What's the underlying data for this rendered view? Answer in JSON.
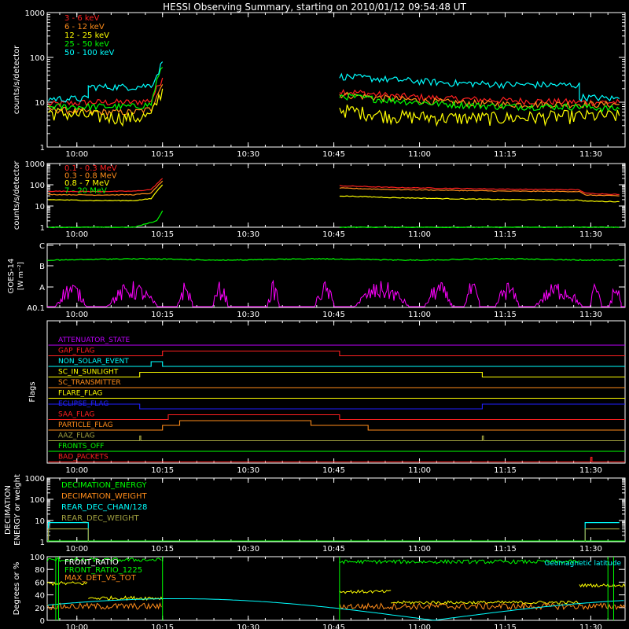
{
  "title": "HESSI Observing Summary, starting on 2010/01/12 09:54:48 UT",
  "time_axis": {
    "labels": [
      "10:00",
      "10:15",
      "10:30",
      "10:45",
      "11:00",
      "11:15",
      "11:30"
    ],
    "minor_ticks_per_label": 5
  },
  "colors": {
    "red": "#ff2020",
    "orange": "#ff8c1a",
    "yellow": "#ffff00",
    "green": "#00ff00",
    "cyan": "#00ffff",
    "magenta": "#ff00ff",
    "blue": "#2020ff",
    "purple": "#c000ff",
    "olive": "#a0a040",
    "white": "#ffffff"
  },
  "chart_data": [
    {
      "type": "line",
      "panel": "low-energy",
      "ylabel": "counts/s/detector",
      "yscale": "log",
      "ylim": [
        1,
        1000
      ],
      "ytick_labels": [
        "1",
        "10",
        "100",
        "1000"
      ],
      "legend": "top-left",
      "series": [
        {
          "name": "3 - 6 keV",
          "color": "red",
          "segments": [
            {
              "x": [
                "09:55",
                "10:03",
                "10:10",
                "10:13",
                "10:14",
                "10:15"
              ],
              "y": [
                9,
                10,
                10,
                11,
                20,
                35
              ]
            },
            {
              "x": [
                "10:46",
                "10:55",
                "11:05",
                "11:15",
                "11:28",
                "11:35"
              ],
              "y": [
                18,
                14,
                12,
                11,
                10,
                10
              ]
            }
          ]
        },
        {
          "name": "6 - 12 keV",
          "color": "orange",
          "segments": [
            {
              "x": [
                "09:55",
                "10:03",
                "10:10",
                "10:13",
                "10:14",
                "10:15"
              ],
              "y": [
                7,
                6,
                6,
                7,
                15,
                25
              ]
            },
            {
              "x": [
                "10:46",
                "10:55",
                "11:05",
                "11:15",
                "11:28",
                "11:35"
              ],
              "y": [
                15,
                12,
                10,
                9,
                9,
                9
              ]
            }
          ]
        },
        {
          "name": "12 - 25 keV",
          "color": "yellow",
          "segments": [
            {
              "x": [
                "09:55",
                "10:02",
                "10:10",
                "10:13",
                "10:14",
                "10:15"
              ],
              "y": [
                6,
                5,
                4.5,
                5,
                10,
                20
              ]
            },
            {
              "x": [
                "10:46",
                "10:55",
                "11:05",
                "11:15",
                "11:28",
                "11:35"
              ],
              "y": [
                7,
                5,
                4.5,
                4.5,
                5,
                5
              ]
            }
          ]
        },
        {
          "name": "25 - 50 keV",
          "color": "green",
          "segments": [
            {
              "x": [
                "09:55",
                "10:03",
                "10:10",
                "10:13",
                "10:14",
                "10:15"
              ],
              "y": [
                8,
                8,
                8,
                9,
                30,
                60
              ]
            },
            {
              "x": [
                "10:46",
                "10:55",
                "11:05",
                "11:15",
                "11:28",
                "11:35"
              ],
              "y": [
                14,
                11,
                9,
                8,
                8,
                7
              ]
            }
          ]
        },
        {
          "name": "50 - 100 keV",
          "color": "cyan",
          "segments": [
            {
              "x": [
                "09:55",
                "10:02",
                "10:02",
                "10:10",
                "10:13",
                "10:14",
                "10:15"
              ],
              "y": [
                12,
                12,
                22,
                22,
                24,
                40,
                80
              ]
            },
            {
              "x": [
                "10:46",
                "10:55",
                "11:05",
                "11:15",
                "11:28",
                "11:28",
                "11:35"
              ],
              "y": [
                38,
                32,
                27,
                25,
                24,
                13,
                12
              ]
            }
          ]
        }
      ]
    },
    {
      "type": "line",
      "panel": "high-energy",
      "ylabel": "counts/s/detector",
      "yscale": "log",
      "ylim": [
        1,
        1000
      ],
      "ytick_labels": [
        "1",
        "10",
        "100",
        "1000"
      ],
      "legend": "top-left",
      "series": [
        {
          "name": "0.1 - 0.3 MeV",
          "color": "red",
          "segments": [
            {
              "x": [
                "09:55",
                "10:03",
                "10:10",
                "10:13",
                "10:14",
                "10:15"
              ],
              "y": [
                50,
                48,
                50,
                60,
                110,
                200
              ]
            },
            {
              "x": [
                "10:46",
                "10:55",
                "11:05",
                "11:15",
                "11:28",
                "11:29",
                "11:35"
              ],
              "y": [
                90,
                75,
                68,
                62,
                58,
                40,
                35
              ]
            }
          ]
        },
        {
          "name": "0.3 - 0.8 MeV",
          "color": "orange",
          "segments": [
            {
              "x": [
                "09:55",
                "10:03",
                "10:10",
                "10:13",
                "10:14",
                "10:15"
              ],
              "y": [
                35,
                33,
                34,
                40,
                80,
                150
              ]
            },
            {
              "x": [
                "10:46",
                "10:55",
                "11:05",
                "11:15",
                "11:28",
                "11:29",
                "11:35"
              ],
              "y": [
                70,
                60,
                55,
                50,
                48,
                33,
                30
              ]
            }
          ]
        },
        {
          "name": "0.8 - 7 MeV",
          "color": "yellow",
          "segments": [
            {
              "x": [
                "09:55",
                "10:03",
                "10:10",
                "10:13",
                "10:14",
                "10:15"
              ],
              "y": [
                20,
                18,
                18,
                22,
                50,
                100
              ]
            },
            {
              "x": [
                "10:46",
                "10:55",
                "11:05",
                "11:15",
                "11:28",
                "11:29",
                "11:35"
              ],
              "y": [
                30,
                25,
                22,
                20,
                19,
                17,
                16
              ]
            }
          ]
        },
        {
          "name": "7 - 20 MeV",
          "color": "green",
          "segments": [
            {
              "x": [
                "09:55",
                "10:10",
                "10:14",
                "10:15"
              ],
              "y": [
                1,
                1,
                2,
                6
              ]
            },
            {
              "x": [
                "10:46",
                "11:35"
              ],
              "y": [
                1,
                1
              ]
            }
          ]
        }
      ]
    },
    {
      "type": "line",
      "panel": "goes",
      "ylabel": "GOES-14",
      "yunits": "[W m⁻²]",
      "yscale": "log-class",
      "ytick_labels": [
        "A0.1",
        "A",
        "B",
        "C"
      ],
      "series": [
        {
          "color": "green",
          "description": "GOES flux just below C level, steady"
        },
        {
          "color": "magenta",
          "description": "noisy bursts between A0.1 and A"
        }
      ]
    },
    {
      "type": "flags",
      "panel": "flags",
      "ylabel": "Flags",
      "flags": [
        {
          "name": "ATTENUATOR_STATE",
          "color": "purple",
          "level": [
            [
              0,
              "09:55"
            ]
          ]
        },
        {
          "name": "GAP_FLAG",
          "color": "red",
          "level": [
            [
              0,
              "09:55"
            ],
            [
              1,
              "10:15"
            ],
            [
              0,
              "10:46"
            ]
          ]
        },
        {
          "name": "NON_SOLAR_EVENT",
          "color": "cyan",
          "level": [
            [
              0,
              "09:55"
            ],
            [
              1,
              "10:13"
            ],
            [
              0,
              "10:15"
            ]
          ]
        },
        {
          "name": "SC_IN_SUNLIGHT",
          "color": "yellow",
          "level": [
            [
              0,
              "09:55"
            ],
            [
              1,
              "10:11"
            ],
            [
              0,
              "11:11"
            ]
          ]
        },
        {
          "name": "SC_TRANSMITTER",
          "color": "orange",
          "level": [
            [
              0,
              "09:55"
            ]
          ]
        },
        {
          "name": "FLARE_FLAG",
          "color": "yellow",
          "level": [
            [
              0,
              "09:55"
            ]
          ]
        },
        {
          "name": "ECLIPSE_FLAG",
          "color": "blue",
          "level": [
            [
              1,
              "09:55"
            ],
            [
              0,
              "10:11"
            ],
            [
              1,
              "11:11"
            ]
          ]
        },
        {
          "name": "SAA_FLAG",
          "color": "red",
          "level": [
            [
              0,
              "09:55"
            ],
            [
              1,
              "10:16"
            ],
            [
              0,
              "10:46"
            ]
          ]
        },
        {
          "name": "PARTICLE_FLAG",
          "color": "orange",
          "level": [
            [
              0,
              "09:55"
            ],
            [
              1,
              "10:15"
            ],
            [
              2,
              "10:18"
            ],
            [
              1,
              "10:41"
            ],
            [
              0,
              "10:51"
            ]
          ]
        },
        {
          "name": "AAZ_FLAG",
          "color": "olive",
          "level": [
            [
              0,
              "09:55"
            ],
            [
              1,
              "10:11"
            ],
            [
              0,
              "10:11.2"
            ],
            [
              1,
              "11:11"
            ],
            [
              0,
              "11:11.2"
            ]
          ]
        },
        {
          "name": "FRONTS_OFF",
          "color": "green",
          "level": [
            [
              0,
              "09:55"
            ]
          ]
        },
        {
          "name": "BAD_PACKETS",
          "color": "red",
          "level": [
            [
              0,
              "09:55"
            ],
            [
              1,
              "11:30"
            ],
            [
              0,
              "11:30.2"
            ]
          ]
        }
      ]
    },
    {
      "type": "line",
      "panel": "decimation",
      "ylabel": "DECIMATION\nENERGY or weight",
      "yscale": "log",
      "ytick_labels": [
        "1",
        "10",
        "100",
        "1000"
      ],
      "series": [
        {
          "name": "DECIMATION_ENERGY",
          "color": "green"
        },
        {
          "name": "DECIMATION_WEIGHT",
          "color": "orange"
        },
        {
          "name": "REAR_DEC_CHAN/128",
          "color": "cyan",
          "segments": [
            {
              "x": [
                "09:55",
                "09:55",
                "10:02",
                "10:02"
              ],
              "y": [
                1,
                8,
                8,
                1
              ]
            },
            {
              "x": [
                "11:29",
                "11:29",
                "11:35"
              ],
              "y": [
                1,
                8,
                8
              ]
            }
          ]
        },
        {
          "name": "REAR_DEC_WEIGHT",
          "color": "olive",
          "segments": [
            {
              "x": [
                "09:55",
                "09:55",
                "10:02",
                "10:02"
              ],
              "y": [
                1,
                4,
                4,
                1
              ]
            },
            {
              "x": [
                "11:29",
                "11:29",
                "11:35"
              ],
              "y": [
                1,
                4,
                4
              ]
            }
          ]
        }
      ]
    },
    {
      "type": "line",
      "panel": "ratios",
      "ylabel": "Degrees or %",
      "ylim": [
        0,
        100
      ],
      "ytick_labels": [
        "0",
        "20",
        "40",
        "60",
        "80",
        "100"
      ],
      "annotation": "Geomagnetic latitude",
      "series": [
        {
          "name": "FRONT_RATIO",
          "color": "white"
        },
        {
          "name": "FRONT_RATIO_1225",
          "color": "green"
        },
        {
          "name": "MAX_DET_VS_TOT",
          "color": "orange"
        }
      ]
    }
  ]
}
